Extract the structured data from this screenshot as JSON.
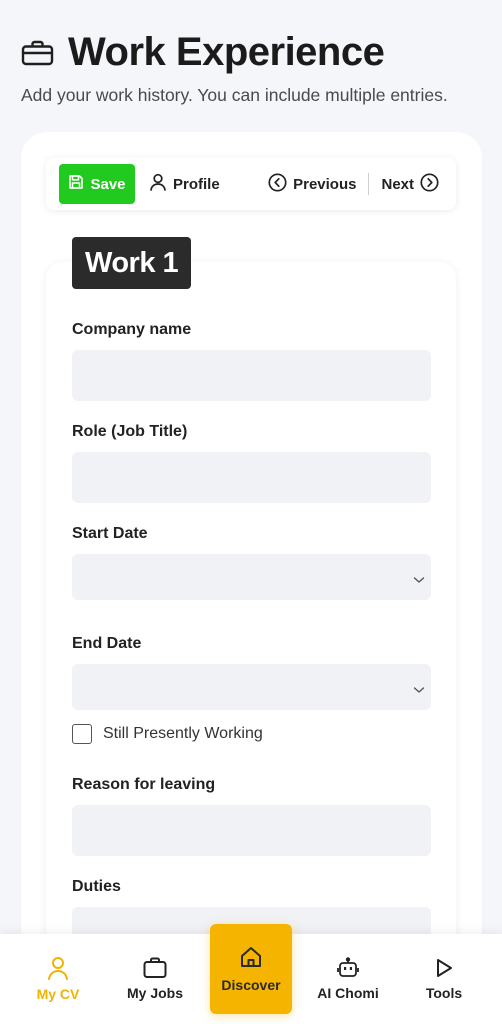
{
  "header": {
    "icon": "briefcase-icon",
    "title": "Work Experience",
    "subtitle": "Add your work history. You can include multiple entries."
  },
  "toolbar": {
    "save_label": "Save",
    "profile_label": "Profile",
    "previous_label": "Previous",
    "next_label": "Next",
    "save_color": "#22c91f"
  },
  "entry": {
    "badge": "Work 1",
    "fields": {
      "company": {
        "label": "Company name",
        "value": ""
      },
      "role": {
        "label": "Role (Job Title)",
        "value": ""
      },
      "start_date": {
        "label": "Start Date",
        "value": ""
      },
      "end_date": {
        "label": "End Date",
        "value": ""
      },
      "still_working": {
        "label": "Still Presently Working",
        "checked": false
      },
      "reason": {
        "label": "Reason for leaving",
        "value": ""
      },
      "duties": {
        "label": "Duties",
        "value": ""
      }
    }
  },
  "bottom_nav": {
    "accent": "#f5b400",
    "items": [
      {
        "label": "My CV",
        "icon": "person-icon",
        "active": true
      },
      {
        "label": "My Jobs",
        "icon": "briefcase-icon",
        "active": false
      },
      {
        "label": "Discover",
        "icon": "home-icon",
        "active": false
      },
      {
        "label": "AI Chomi",
        "icon": "robot-icon",
        "active": false
      },
      {
        "label": "Tools",
        "icon": "play-icon",
        "active": false
      }
    ]
  }
}
